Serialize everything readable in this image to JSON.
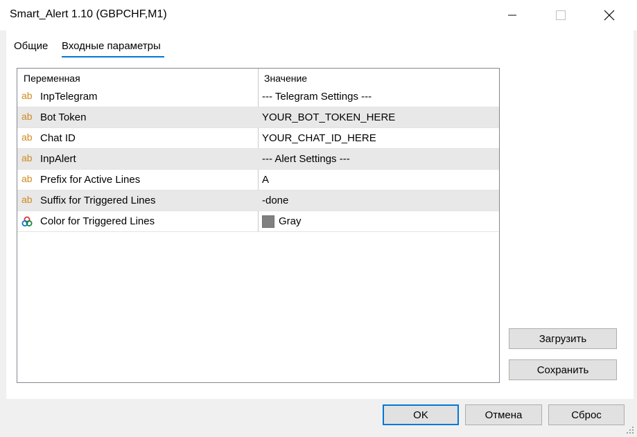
{
  "window": {
    "title": "Smart_Alert 1.10 (GBPCHF,M1)"
  },
  "tabs": [
    {
      "label": "Общие",
      "active": false
    },
    {
      "label": "Входные параметры",
      "active": true
    }
  ],
  "grid": {
    "columns": [
      "Переменная",
      "Значение"
    ],
    "rows": [
      {
        "icon": "text-type-icon",
        "icon_text": "ab",
        "name": "InpTelegram",
        "value": "--- Telegram Settings ---"
      },
      {
        "icon": "text-type-icon",
        "icon_text": "ab",
        "name": "Bot Token",
        "value": "YOUR_BOT_TOKEN_HERE"
      },
      {
        "icon": "text-type-icon",
        "icon_text": "ab",
        "name": "Chat ID",
        "value": "YOUR_CHAT_ID_HERE"
      },
      {
        "icon": "text-type-icon",
        "icon_text": "ab",
        "name": "InpAlert",
        "value": "--- Alert Settings ---"
      },
      {
        "icon": "text-type-icon",
        "icon_text": "ab",
        "name": "Prefix for Active Lines",
        "value": "A"
      },
      {
        "icon": "text-type-icon",
        "icon_text": "ab",
        "name": "Suffix for Triggered Lines",
        "value": "-done"
      },
      {
        "icon": "color-type-icon",
        "name": "Color for Triggered Lines",
        "value": "Gray",
        "swatch_color": "#808080"
      }
    ]
  },
  "side_buttons": {
    "load_label": "Загрузить",
    "save_label": "Сохранить"
  },
  "footer_buttons": {
    "ok_label": "OK",
    "cancel_label": "Отмена",
    "reset_label": "Сброс"
  },
  "colors": {
    "accent": "#0078d7",
    "text_type_icon": "#cf8a1f",
    "alt_row": "#e8e8e8"
  }
}
